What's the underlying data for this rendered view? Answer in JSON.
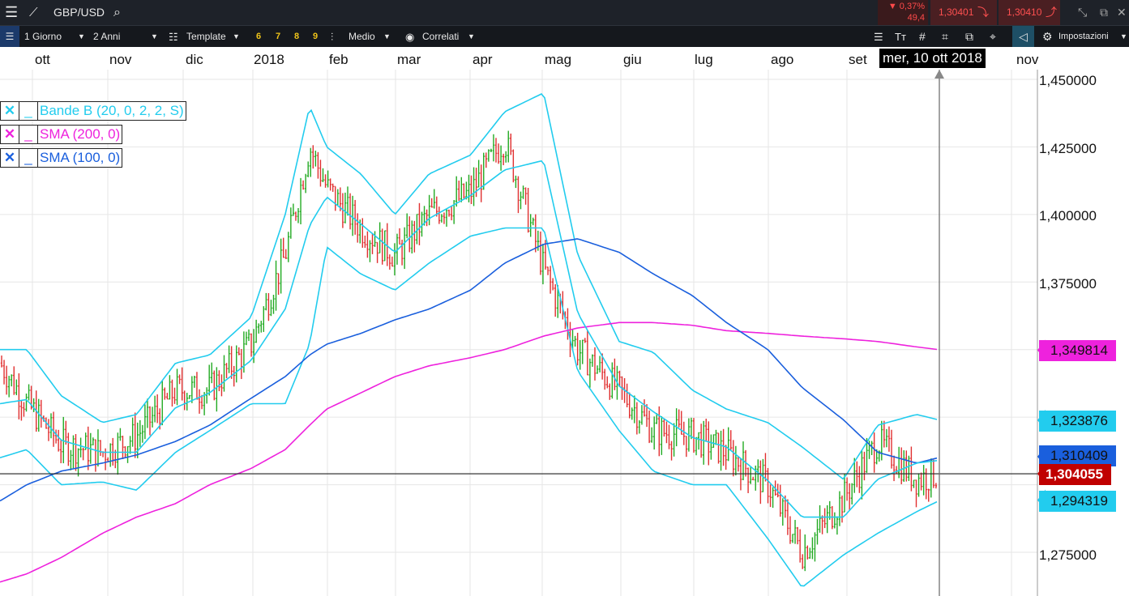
{
  "toolbar_top": {
    "symbol": "GBP/USD",
    "change_pct": "▼ 0,37%",
    "change_sub": "49,4",
    "bid": "1,30401",
    "ask": "1,30410"
  },
  "toolbar": {
    "timeframe": "1 Giorno",
    "range": "2 Anni",
    "template": "Template",
    "nums": [
      "6",
      "7",
      "8",
      "9"
    ],
    "type": "Medio",
    "related": "Correlati",
    "settings": "Impostazioni"
  },
  "cursor_date": "mer, 10 ott 2018",
  "colors": {
    "up": "#22aa22",
    "down": "#e03030",
    "bollinger": "#22ccee",
    "sma200": "#ee22dd",
    "sma100": "#1a5fdd",
    "price": "#c00000"
  },
  "chart_data": {
    "type": "line",
    "instrument": "GBP/USD",
    "x_tick_labels": [
      "ott",
      "nov",
      "dic",
      "2018",
      "feb",
      "mar",
      "apr",
      "mag",
      "giu",
      "lug",
      "ago",
      "set",
      "nov"
    ],
    "y_tick_labels": [
      "1,450000",
      "1,425000",
      "1,400000",
      "1,375000",
      "1,275000"
    ],
    "ylim": [
      1.255,
      1.455
    ],
    "grid": true,
    "legend": [
      {
        "label": "Bande B (20, 0, 2, 2, S)",
        "color": "#22ccee"
      },
      {
        "label": "SMA (200, 0)",
        "color": "#ee22dd"
      },
      {
        "label": "SMA (100, 0)",
        "color": "#1a5fdd"
      }
    ],
    "last_values": [
      {
        "label": "1,349814",
        "value": 1.349814,
        "series": "SMA (200, 0)"
      },
      {
        "label": "1,323876",
        "value": 1.323876,
        "series": "Bande B upper"
      },
      {
        "label": "1,310409",
        "value": 1.310409,
        "series": "SMA (100, 0)"
      },
      {
        "label": "1,304055",
        "value": 1.304055,
        "series": "price"
      },
      {
        "label": "1,294319",
        "value": 1.294319,
        "series": "Bande B lower"
      }
    ],
    "x": [
      "2017-09-20",
      "2017-10-01",
      "2017-10-15",
      "2017-11-01",
      "2017-11-15",
      "2017-12-01",
      "2017-12-15",
      "2018-01-01",
      "2018-01-15",
      "2018-01-25",
      "2018-02-01",
      "2018-02-15",
      "2018-03-01",
      "2018-03-15",
      "2018-04-01",
      "2018-04-15",
      "2018-05-01",
      "2018-05-15",
      "2018-06-01",
      "2018-06-15",
      "2018-07-01",
      "2018-07-15",
      "2018-08-01",
      "2018-08-15",
      "2018-09-01",
      "2018-09-15",
      "2018-10-01",
      "2018-10-10"
    ],
    "series": [
      {
        "name": "price",
        "values": [
          1.345,
          1.33,
          1.315,
          1.312,
          1.318,
          1.335,
          1.335,
          1.352,
          1.385,
          1.425,
          1.41,
          1.395,
          1.385,
          1.4,
          1.408,
          1.428,
          1.38,
          1.35,
          1.335,
          1.32,
          1.318,
          1.312,
          1.3,
          1.275,
          1.295,
          1.316,
          1.302,
          1.304
        ]
      },
      {
        "name": "Bande B (20, 0, 2, 2, S)",
        "values": [
          1.35,
          1.35,
          1.333,
          1.323,
          1.326,
          1.345,
          1.348,
          1.362,
          1.4,
          1.44,
          1.425,
          1.415,
          1.4,
          1.415,
          1.422,
          1.438,
          1.445,
          1.385,
          1.353,
          1.349,
          1.335,
          1.328,
          1.323,
          1.314,
          1.302,
          1.322,
          1.326,
          1.324
        ]
      },
      {
        "name": "Bande B lower",
        "values": [
          1.31,
          1.313,
          1.3,
          1.301,
          1.298,
          1.312,
          1.32,
          1.33,
          1.33,
          1.352,
          1.388,
          1.378,
          1.372,
          1.382,
          1.392,
          1.395,
          1.395,
          1.342,
          1.32,
          1.305,
          1.3,
          1.3,
          1.28,
          1.262,
          1.274,
          1.282,
          1.29,
          1.294
        ]
      },
      {
        "name": "SMA (200, 0)",
        "values": [
          1.264,
          1.267,
          1.273,
          1.282,
          1.288,
          1.293,
          1.3,
          1.306,
          1.313,
          1.322,
          1.328,
          1.334,
          1.34,
          1.344,
          1.347,
          1.35,
          1.355,
          1.358,
          1.36,
          1.36,
          1.359,
          1.357,
          1.356,
          1.355,
          1.354,
          1.353,
          1.351,
          1.35
        ]
      },
      {
        "name": "SMA (100, 0)",
        "values": [
          1.294,
          1.3,
          1.305,
          1.308,
          1.311,
          1.316,
          1.322,
          1.332,
          1.34,
          1.348,
          1.352,
          1.356,
          1.361,
          1.365,
          1.372,
          1.382,
          1.389,
          1.391,
          1.386,
          1.378,
          1.37,
          1.36,
          1.35,
          1.336,
          1.324,
          1.312,
          1.308,
          1.31
        ]
      }
    ]
  }
}
